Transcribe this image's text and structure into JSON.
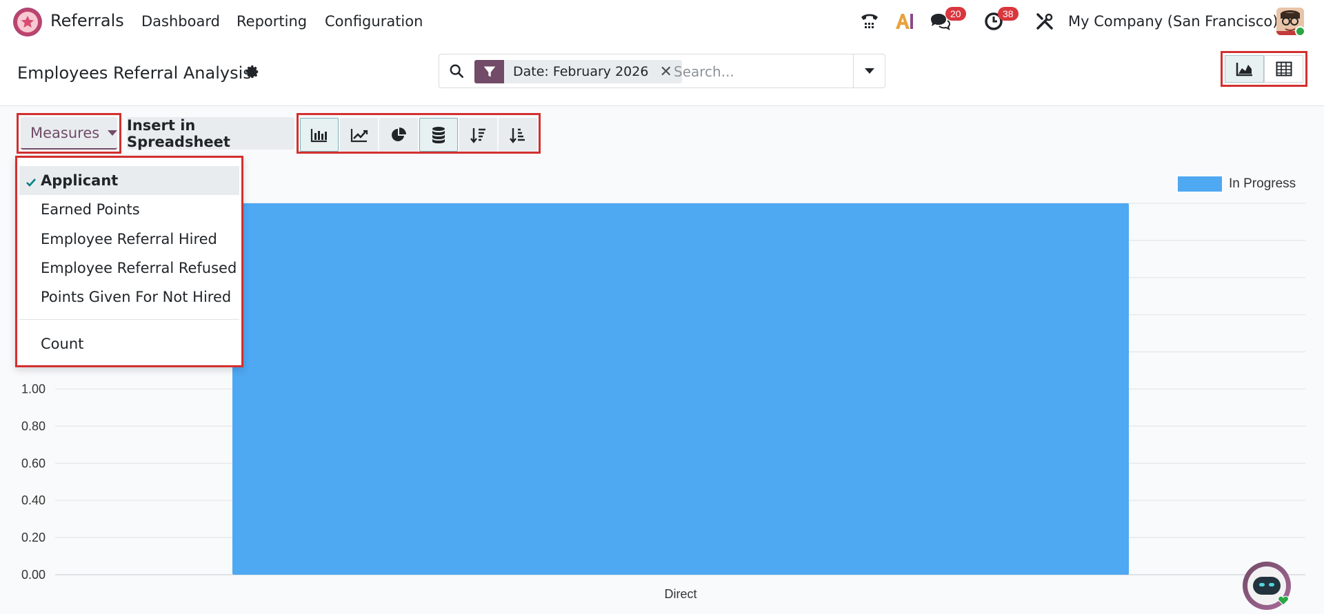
{
  "app": {
    "name": "Referrals",
    "nav": [
      "Dashboard",
      "Reporting",
      "Configuration"
    ],
    "company": "My Company (San Francisco)",
    "badges": {
      "messages": "20",
      "activities": "38"
    },
    "icons": [
      "phone-icon",
      "ai-icon",
      "chat-icon",
      "clock-icon",
      "tools-icon"
    ]
  },
  "control": {
    "title": "Employees Referral Analysis",
    "facet": "Date: February 2026",
    "search_placeholder": "Search..."
  },
  "toolbar": {
    "measures_label": "Measures",
    "insert_label": "Insert in Spreadsheet"
  },
  "measures_menu": {
    "items": [
      "Applicant",
      "Earned Points",
      "Employee Referral Hired",
      "Employee Referral Refused",
      "Points Given For Not Hired"
    ],
    "count": "Count",
    "selected": "Applicant"
  },
  "chart_data": {
    "type": "bar",
    "categories": [
      "Direct"
    ],
    "series": [
      {
        "name": "In Progress",
        "values": [
          2.0
        ]
      }
    ],
    "ylim": [
      0,
      2.0
    ],
    "yticks": [
      "0.00",
      "0.20",
      "0.40",
      "0.60",
      "0.80",
      "1.00"
    ],
    "color": "#4ea8f2",
    "legend": "top-right"
  }
}
